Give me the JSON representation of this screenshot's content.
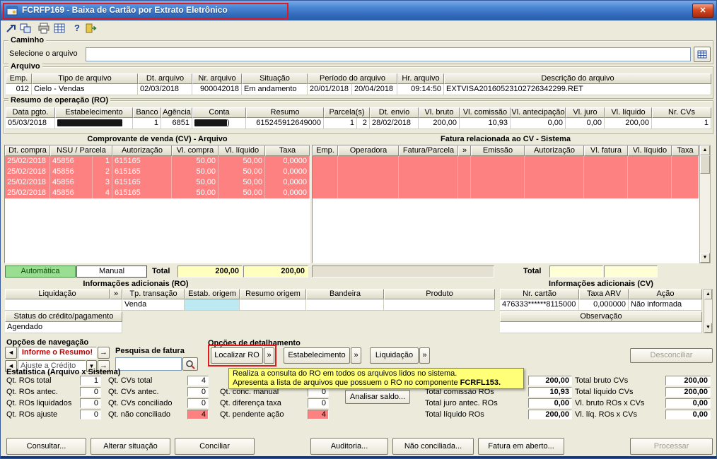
{
  "window": {
    "title": "FCRFP169 - Baixa de Cartão por Extrato Eletrônico"
  },
  "icons": {
    "close": "✕",
    "help": "?",
    "up": "▲",
    "down": "▼",
    "left": "◄",
    "right": "→",
    "dropdown": "▼",
    "more": "»"
  },
  "colors": {
    "unreconciled_row": "#fd8181",
    "auto_button_bg": "#9ade92",
    "total_field_bg": "#ffffbe",
    "highlight_cell_bg": "#bdeaf2",
    "tooltip_bg": "#ffff78",
    "annotation": "#e11b1b"
  },
  "caminho": {
    "legend": "Caminho",
    "file_label": "Selecione o arquivo",
    "file_value": ""
  },
  "arquivo": {
    "legend": "Arquivo",
    "headers": [
      "Emp.",
      "Tipo de arquivo",
      "Dt. arquivo",
      "Nr. arquivo",
      "Situação",
      "Período do arquivo",
      "Hr. arquivo",
      "Descrição do arquivo"
    ],
    "row": {
      "emp": "012",
      "tipo": "Cielo - Vendas",
      "dt_arquivo": "02/03/2018",
      "nr_arquivo": "900042018",
      "situacao": "Em andamento",
      "periodo_inicio": "20/01/2018",
      "periodo_fim": "20/04/2018",
      "hr_arquivo": "09:14:50",
      "descricao": "EXTVISA20160523102726342299.RET"
    }
  },
  "resumo": {
    "legend": "Resumo de operação (RO)",
    "headers": [
      "Data pgto.",
      "Estabelecimento",
      "Banco",
      "Agência",
      "Conta",
      "Resumo",
      "Parcela(s)",
      "Dt. envio",
      "Vl. bruto",
      "Vl. comissão",
      "Vl. antecipação",
      "Vl. juro",
      "Vl. líquido",
      "Nr. CVs"
    ],
    "row": {
      "data_pgto": "05/03/2018",
      "banco": "1",
      "agencia": "6851",
      "conta_sufixo": ")",
      "resumo": "615245912649000",
      "parcela": "1",
      "parcela_total": "2",
      "dt_envio": "28/02/2018",
      "vl_bruto": "200,00",
      "vl_comissao": "10,93",
      "vl_antecipacao": "0,00",
      "vl_juro": "0,00",
      "vl_liquido": "200,00",
      "nr_cvs": "1"
    }
  },
  "cv": {
    "title": "Comprovante de venda (CV) - Arquivo",
    "headers": [
      "Dt. compra",
      "NSU / Parcela",
      "Autorização",
      "Vl. compra",
      "Vl. líquido",
      "Taxa"
    ],
    "rows": [
      [
        "25/02/2018",
        "45856",
        "1",
        "615165",
        "50,00",
        "50,00",
        "0,0000"
      ],
      [
        "25/02/2018",
        "45856",
        "2",
        "615165",
        "50,00",
        "50,00",
        "0,0000"
      ],
      [
        "25/02/2018",
        "45856",
        "3",
        "615165",
        "50,00",
        "50,00",
        "0,0000"
      ],
      [
        "25/02/2018",
        "45856",
        "4",
        "615165",
        "50,00",
        "50,00",
        "0,0000"
      ]
    ],
    "auto_button": "Automática",
    "manual_button": "Manual",
    "total_label": "Total",
    "total_compra": "200,00",
    "total_liquido": "200,00"
  },
  "fatura": {
    "title": "Fatura relacionada ao CV - Sistema",
    "headers": [
      "Emp.",
      "Operadora",
      "Fatura/Parcela",
      "»",
      "Emissão",
      "Autorização",
      "Vl. fatura",
      "Vl. líquido",
      "Taxa"
    ],
    "total_label": "Total"
  },
  "info_ro": {
    "title": "Informações adicionais (RO)",
    "h_liquidacao": "Liquidação",
    "h_more": "»",
    "h_tp_transacao": "Tp. transação",
    "h_estab_origem": "Estab. origem",
    "h_resumo_origem": "Resumo origem",
    "h_bandeira": "Bandeira",
    "h_produto": "Produto",
    "tp_transacao": "Venda",
    "status_label": "Status do crédito/pagamento",
    "status_value": "Agendado"
  },
  "info_cv": {
    "title": "Informações adicionais (CV)",
    "h_nr_cartao": "Nr. cartão",
    "h_taxa_arv": "Taxa ARV",
    "h_acao": "Ação",
    "nr_cartao": "476333******8115000",
    "taxa_arv": "0,000000",
    "acao": "Não informada",
    "obs_label": "Observação"
  },
  "navegacao": {
    "title": "Opções de navegação",
    "resumo_combo": "Informe o Resumo!",
    "ajuste_combo": "Ajuste a Crédito"
  },
  "pesquisa": {
    "title": "Pesquisa de fatura",
    "value": ""
  },
  "detalhamento": {
    "title": "Opções de detalhamento",
    "localizar_ro": "Localizar RO",
    "estabelecimento": "Estabelecimento",
    "liquidacao": "Liquidação",
    "more": "»"
  },
  "desconciliar_button": "Desconciliar",
  "tooltip": {
    "line1": "Realiza a consulta do RO em todos os arquivos lidos no sistema.",
    "line2_prefix": "Apresenta a lista de arquivos que possuem o RO no componente ",
    "line2_bold": "FCRFL153."
  },
  "estatistica": {
    "title": "Estatística (Arquivo x Sistema)",
    "col1": [
      {
        "label": "Qt. ROs total",
        "value": "1"
      },
      {
        "label": "Qt. ROs antec.",
        "value": "0"
      },
      {
        "label": "Qt. ROs liquidados",
        "value": "0"
      },
      {
        "label": "Qt. ROs ajuste",
        "value": "0"
      }
    ],
    "col2": [
      {
        "label": "Qt. CVs total",
        "value": "4"
      },
      {
        "label": "Qt. CVs antec.",
        "value": "0"
      },
      {
        "label": "Qt. CVs conciliado",
        "value": "0"
      },
      {
        "label": "Qt. não conciliado",
        "value": "4"
      }
    ],
    "col3": [
      {
        "label": "Qt. conc. manual",
        "value": "0"
      },
      {
        "label": "Qt. diferença taxa",
        "value": "0"
      },
      {
        "label": "Qt. pendente ação",
        "value": "4"
      }
    ],
    "col4_row1_value": "200,00",
    "col4": [
      {
        "label": "Total comissão ROs",
        "value": "10,93"
      },
      {
        "label": "Total juro antec. ROs",
        "value": "0,00"
      },
      {
        "label": "Total líquido ROs",
        "value": "200,00"
      }
    ],
    "col5": [
      {
        "label": "Total bruto CVs",
        "value": "200,00"
      },
      {
        "label": "Total líquido CVs",
        "value": "200,00"
      },
      {
        "label": "Vl. bruto ROs x CVs",
        "value": "0,00"
      },
      {
        "label": "Vl. líq. ROs x CVs",
        "value": "0,00"
      }
    ],
    "analisar_button": "Analisar saldo..."
  },
  "footer": {
    "buttons": [
      "Consultar...",
      "Alterar situação",
      "Conciliar",
      "Auditoria...",
      "Não conciliada...",
      "Fatura em aberto...",
      "Processar"
    ]
  }
}
